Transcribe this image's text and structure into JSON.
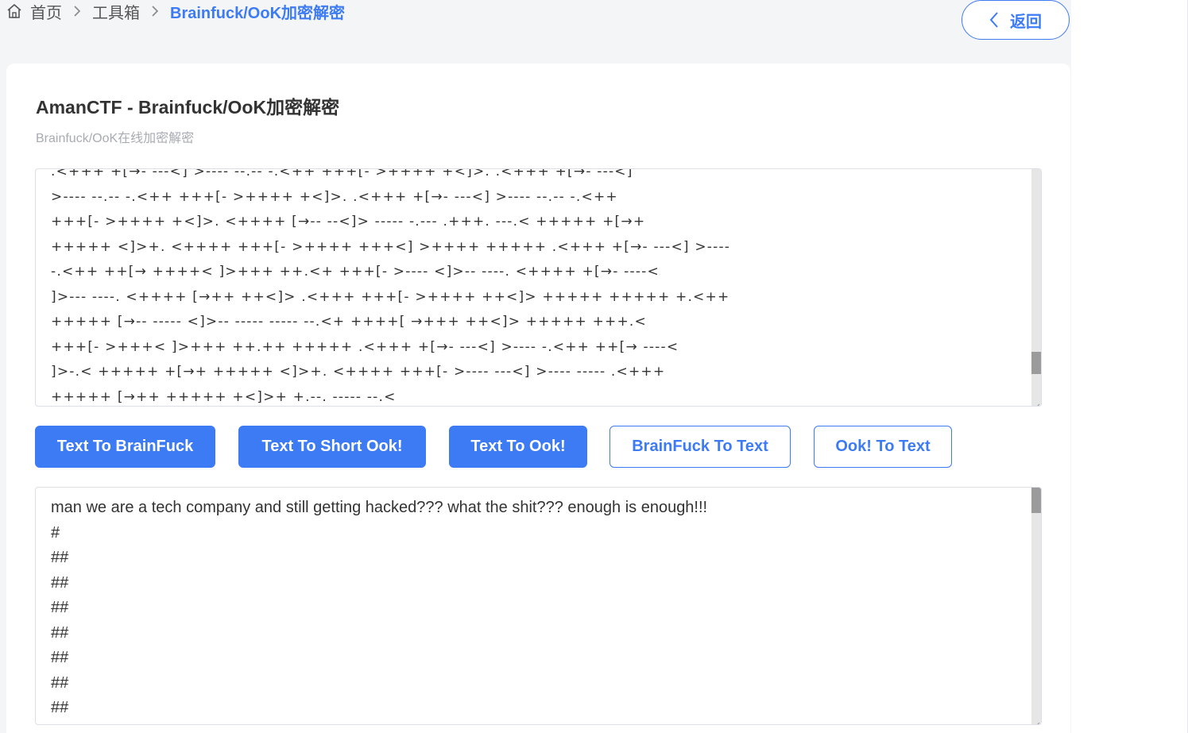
{
  "breadcrumb": {
    "home": "首页",
    "toolbox": "工具箱",
    "current": "Brainfuck/OoK加密解密"
  },
  "back_button": {
    "label": "返回"
  },
  "card": {
    "title": "AmanCTF - Brainfuck/OoK加密解密",
    "subtitle": "Brainfuck/OoK在线加密解密"
  },
  "input": {
    "lines": [
      ".<+++ +[→- ---<] >---- --.-- -.<++ +++[- >++++ +<]>. .<+++ +[→- ---<]",
      ">---- --.-- -.<++ +++[- >++++ +<]>. .<+++ +[→- ---<] >---- --.-- -.<++",
      "+++[- >++++ +<]>. <++++ [→-- --<]> ----- -.--- .+++. ---.< +++++ +[→+",
      "+++++ <]>+. <++++ +++[- >++++ +++<] >++++ +++++ .<+++ +[→- ---<] >----",
      "-.<++ ++[→ ++++< ]>+++ ++.<+ +++[- >---- <]>-- ----. <++++ +[→- ----<",
      "]>--- ----. <++++ [→++ ++<]> .<+++ +++[- >++++ ++<]> +++++ +++++ +.<++",
      "+++++ [→-- ----- <]>-- ----- ----- --.<+ ++++[ →+++ ++<]> +++++ +++.<",
      "+++[- >+++< ]>+++ ++.++ +++++ .<+++ +[→- ---<] >---- -.<++ ++[→ ----<",
      "]>-.< +++++ +[→+ +++++ <]>+. <++++ +++[- >---- ---<] >---- ----- .<+++",
      "+++++ [→++ +++++ +<]>+ +.--. ----- --.<"
    ],
    "scroll_position": 0.85
  },
  "buttons": [
    {
      "label": "Text To BrainFuck",
      "style": "primary"
    },
    {
      "label": "Text To Short Ook!",
      "style": "primary"
    },
    {
      "label": "Text To Ook!",
      "style": "primary"
    },
    {
      "label": "BrainFuck To Text",
      "style": "outline"
    },
    {
      "label": "Ook! To Text",
      "style": "outline"
    }
  ],
  "output": {
    "lines": [
      "man we are a tech company and still getting hacked??? what the shit??? enough is enough!!!",
      "#",
      "##",
      "##",
      "##",
      "##",
      "##",
      "##",
      "##"
    ],
    "scroll_position": 0.0
  },
  "colors": {
    "accent": "#3d7bf5",
    "background": "#f4f5f7",
    "card": "#ffffff",
    "text": "#333333",
    "muted": "#a9abb3"
  }
}
